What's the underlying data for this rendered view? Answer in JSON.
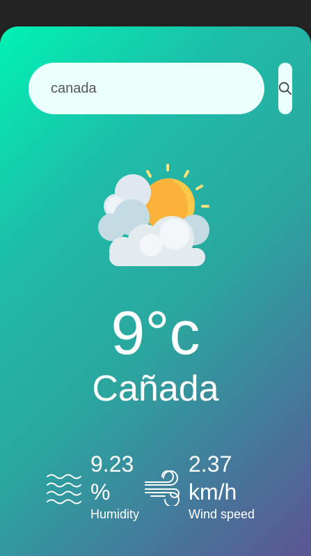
{
  "search": {
    "value": "canada",
    "icon": "search-icon"
  },
  "weather": {
    "icon": "partly-cloudy-icon",
    "temperature": "9°c",
    "city": "Cañada"
  },
  "humidity": {
    "icon": "humidity-waves-icon",
    "value": "9.23",
    "unit": "%",
    "label": "Humidity"
  },
  "wind": {
    "icon": "wind-icon",
    "value": "2.37",
    "unit": "km/h",
    "label": "Wind speed"
  },
  "colors": {
    "gradient_start": "#00f2b4",
    "gradient_end": "#5c5593",
    "search_bg": "#ebfffc",
    "text": "#ffffff"
  }
}
